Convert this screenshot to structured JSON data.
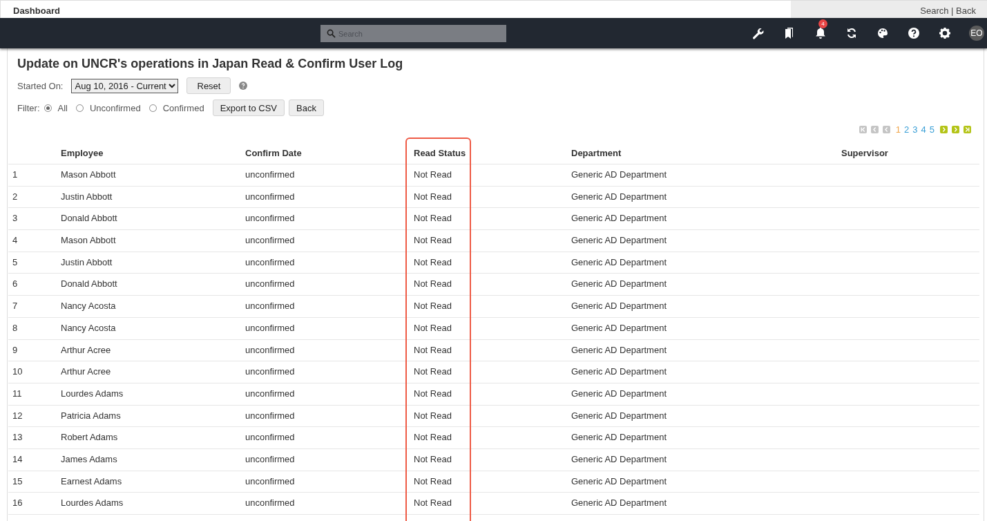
{
  "top_strip": {
    "title": "Dashboard",
    "links": "Search | Back"
  },
  "navbar": {
    "search": {
      "placeholder": "Search"
    },
    "notifications": {
      "badge": "4"
    },
    "avatar": "EO"
  },
  "page": {
    "title": "Update on UNCR's operations in Japan Read & Confirm User Log",
    "started_on": {
      "label": "Started On:",
      "value": "Aug 10, 2016 - Current",
      "reset": "Reset"
    },
    "filter": {
      "label": "Filter:",
      "options": [
        {
          "label": "All",
          "selected": true
        },
        {
          "label": "Unconfirmed",
          "selected": false
        },
        {
          "label": "Confirmed",
          "selected": false
        }
      ]
    },
    "buttons": [
      "Export to CSV",
      "Back"
    ]
  },
  "pagination": {
    "nav_before": [
      {
        "kind": "first",
        "disabled": true
      },
      {
        "kind": "prev",
        "disabled": true
      },
      {
        "kind": "prev",
        "disabled": true
      }
    ],
    "pages": [
      {
        "label": "1",
        "selected": true
      },
      {
        "label": "2",
        "selected": false
      },
      {
        "label": "3",
        "selected": false
      },
      {
        "label": "4",
        "selected": false
      },
      {
        "label": "5",
        "selected": false
      }
    ],
    "nav_after": [
      {
        "kind": "next",
        "disabled": false
      },
      {
        "kind": "next",
        "disabled": false
      },
      {
        "kind": "last",
        "disabled": false
      }
    ]
  },
  "table": {
    "columns": [
      "",
      "Employee",
      "Confirm Date",
      "Read Status",
      "Department",
      "Supervisor"
    ],
    "rows": [
      [
        "1",
        "Mason Abbott",
        "unconfirmed",
        "Not Read",
        "Generic AD Department"
      ],
      [
        "2",
        "Justin Abbott",
        "unconfirmed",
        "Not Read",
        "Generic AD Department"
      ],
      [
        "3",
        "Donald Abbott",
        "unconfirmed",
        "Not Read",
        "Generic AD Department"
      ],
      [
        "4",
        "Mason Abbott",
        "unconfirmed",
        "Not Read",
        "Generic AD Department"
      ],
      [
        "5",
        "Justin Abbott",
        "unconfirmed",
        "Not Read",
        "Generic AD Department"
      ],
      [
        "6",
        "Donald Abbott",
        "unconfirmed",
        "Not Read",
        "Generic AD Department"
      ],
      [
        "7",
        "Nancy Acosta",
        "unconfirmed",
        "Not Read",
        "Generic AD Department"
      ],
      [
        "8",
        "Nancy Acosta",
        "unconfirmed",
        "Not Read",
        "Generic AD Department"
      ],
      [
        "9",
        "Arthur Acree",
        "unconfirmed",
        "Not Read",
        "Generic AD Department"
      ],
      [
        "10",
        "Arthur Acree",
        "unconfirmed",
        "Not Read",
        "Generic AD Department"
      ],
      [
        "11",
        "Lourdes Adams",
        "unconfirmed",
        "Not Read",
        "Generic AD Department"
      ],
      [
        "12",
        "Patricia Adams",
        "unconfirmed",
        "Not Read",
        "Generic AD Department"
      ],
      [
        "13",
        "Robert Adams",
        "unconfirmed",
        "Not Read",
        "Generic AD Department"
      ],
      [
        "14",
        "James Adams",
        "unconfirmed",
        "Not Read",
        "Generic AD Department"
      ],
      [
        "15",
        "Earnest Adams",
        "unconfirmed",
        "Not Read",
        "Generic AD Department"
      ],
      [
        "16",
        "Lourdes Adams",
        "unconfirmed",
        "Not Read",
        "Generic AD Department"
      ]
    ]
  }
}
